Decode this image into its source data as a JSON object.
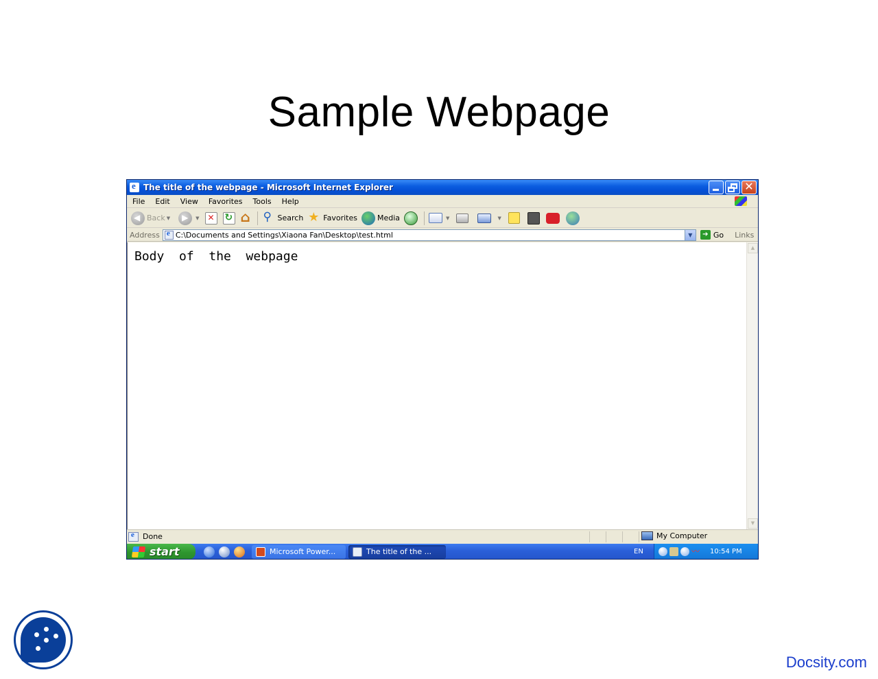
{
  "slide": {
    "title": "Sample Webpage",
    "watermark": "Docsity.com"
  },
  "window": {
    "title": "The title of the webpage - Microsoft Internet Explorer",
    "menu": [
      "File",
      "Edit",
      "View",
      "Favorites",
      "Tools",
      "Help"
    ],
    "toolbar": {
      "back_label": "Back",
      "search_label": "Search",
      "favorites_label": "Favorites",
      "media_label": "Media"
    },
    "address": {
      "label": "Address",
      "value": "C:\\Documents and Settings\\Xiaona Fan\\Desktop\\test.html",
      "go_label": "Go",
      "links_label": "Links"
    },
    "content": {
      "body_text": "Body  of  the  webpage"
    },
    "status": {
      "text": "Done",
      "zone": "My Computer"
    }
  },
  "taskbar": {
    "start_label": "start",
    "tasks": [
      {
        "label": "Microsoft Power..."
      },
      {
        "label": "The title of the ..."
      }
    ],
    "language": "EN",
    "clock": "10:54 PM"
  },
  "colors": {
    "titlebar_blue": "#0550d6",
    "taskbar_blue": "#2a5fd8",
    "start_green": "#2e962e",
    "docsity_blue": "#1a3dcc",
    "logo_blue": "#0a3f99"
  }
}
